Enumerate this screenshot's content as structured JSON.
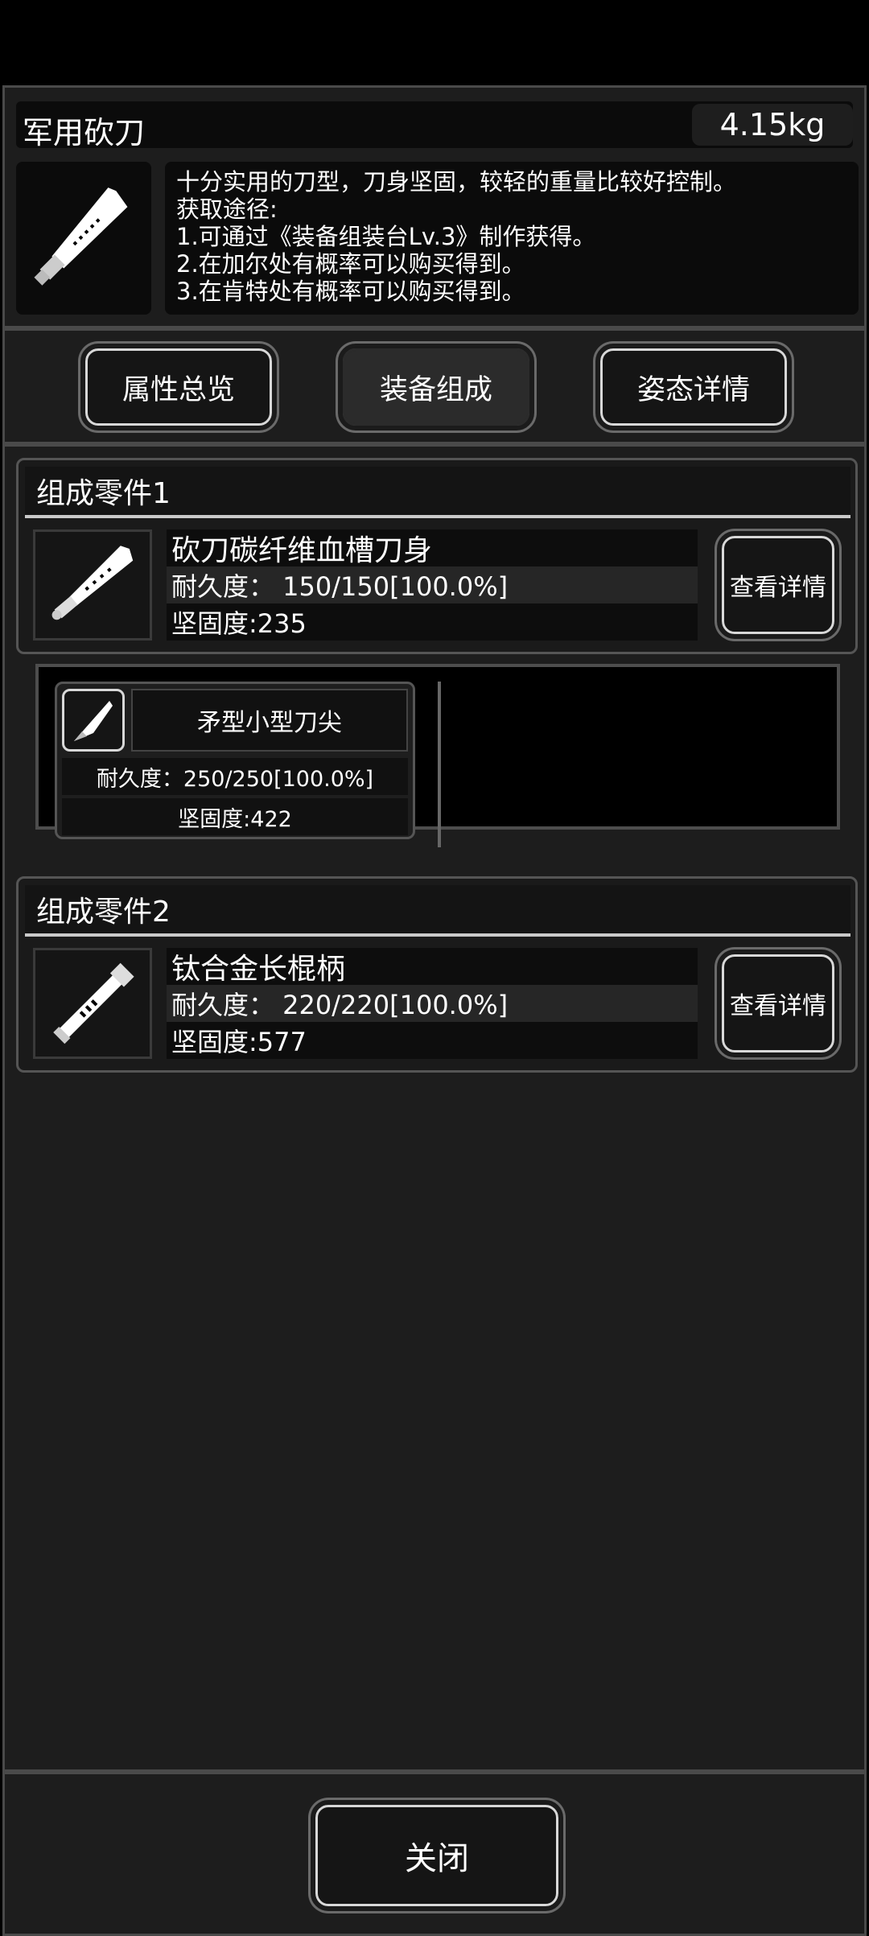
{
  "item": {
    "name": "军用砍刀",
    "weight": "4.15kg",
    "description_lines": [
      "十分实用的刀型，刀身坚固，较轻的重量比较好控制。",
      "获取途径:",
      "1.可通过《装备组装台Lv.3》制作获得。",
      "2.在加尔处有概率可以购买得到。",
      "3.在肯特处有概率可以购买得到。"
    ],
    "icon": "machete-icon"
  },
  "tabs": [
    {
      "label": "属性总览"
    },
    {
      "label": "装备组成"
    },
    {
      "label": "姿态详情"
    }
  ],
  "parts": [
    {
      "header": "组成零件1",
      "name": "砍刀碳纤维血槽刀身",
      "durability": "耐久度：  150/150[100.0%]",
      "hardness": "坚固度:235",
      "details_label": "查看详情",
      "icon": "blade-icon"
    },
    {
      "header": "组成零件2",
      "name": "钛合金长棍柄",
      "durability": "耐久度：  220/220[100.0%]",
      "hardness": "坚固度:577",
      "details_label": "查看详情",
      "icon": "handle-icon"
    }
  ],
  "subpart": {
    "name": "矛型小型刀尖",
    "durability": "耐久度：250/250[100.0%]",
    "hardness": "坚固度:422",
    "icon": "blade-tip-icon"
  },
  "footer": {
    "close_label": "关闭"
  },
  "colors": {
    "panel": "#1d1d1d",
    "border": "#4a4a4a",
    "text": "#ffffff"
  }
}
